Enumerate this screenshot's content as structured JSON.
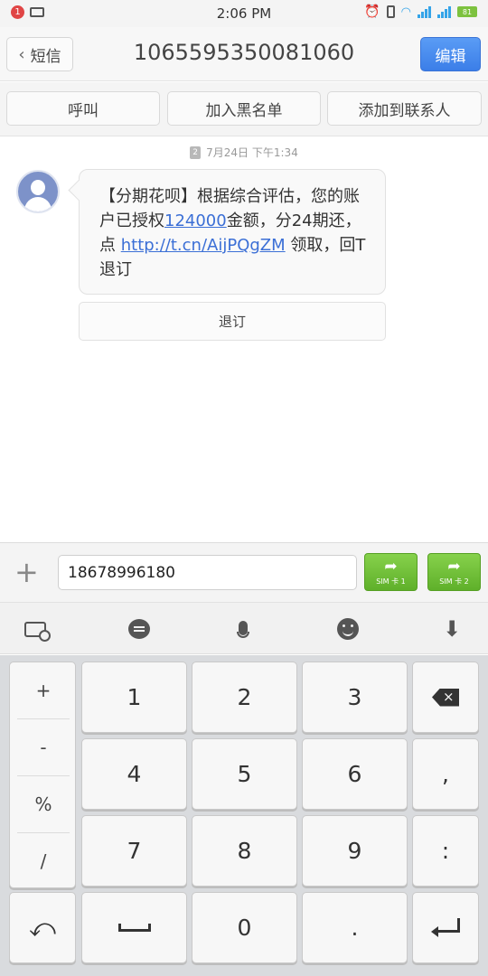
{
  "status_bar": {
    "notification_count": "1",
    "time": "2:06 PM",
    "battery": "81"
  },
  "header": {
    "back_label": "短信",
    "title": "1065595350081060",
    "edit_label": "编辑"
  },
  "actions": {
    "call": "呼叫",
    "blacklist": "加入黑名单",
    "add_contact": "添加到联系人"
  },
  "conversation": {
    "sim_tag": "2",
    "date": "7月24日 下午1:34",
    "message": {
      "part1": "【分期花呗】根据综合评估，您的账户已授权",
      "amount": "124000",
      "part2": "金额，分24期还，点 ",
      "link": "http://t.cn/AijPQgZM",
      "part3": " 领取，回T退订"
    },
    "unsubscribe_label": "退订"
  },
  "compose": {
    "input_value": "18678996180",
    "sim1_label": "SIM 卡 1",
    "sim2_label": "SIM 卡 2"
  },
  "toolbar": {
    "icons": [
      "keyboard-settings-icon",
      "chat-icon",
      "microphone-icon",
      "emoji-icon",
      "hide-keyboard-icon"
    ]
  },
  "keypad": {
    "symbols": [
      "+",
      "-",
      "%",
      "/"
    ],
    "digits": [
      "1",
      "2",
      "3",
      "4",
      "5",
      "6",
      "7",
      "8",
      "9",
      "0"
    ],
    "comma": ",",
    "colon": ":",
    "dot": "."
  },
  "colors": {
    "edit_button": "#3b7ee8",
    "send_button": "#5fb02a",
    "link": "#3b6fd6",
    "notification": "#e04545"
  }
}
